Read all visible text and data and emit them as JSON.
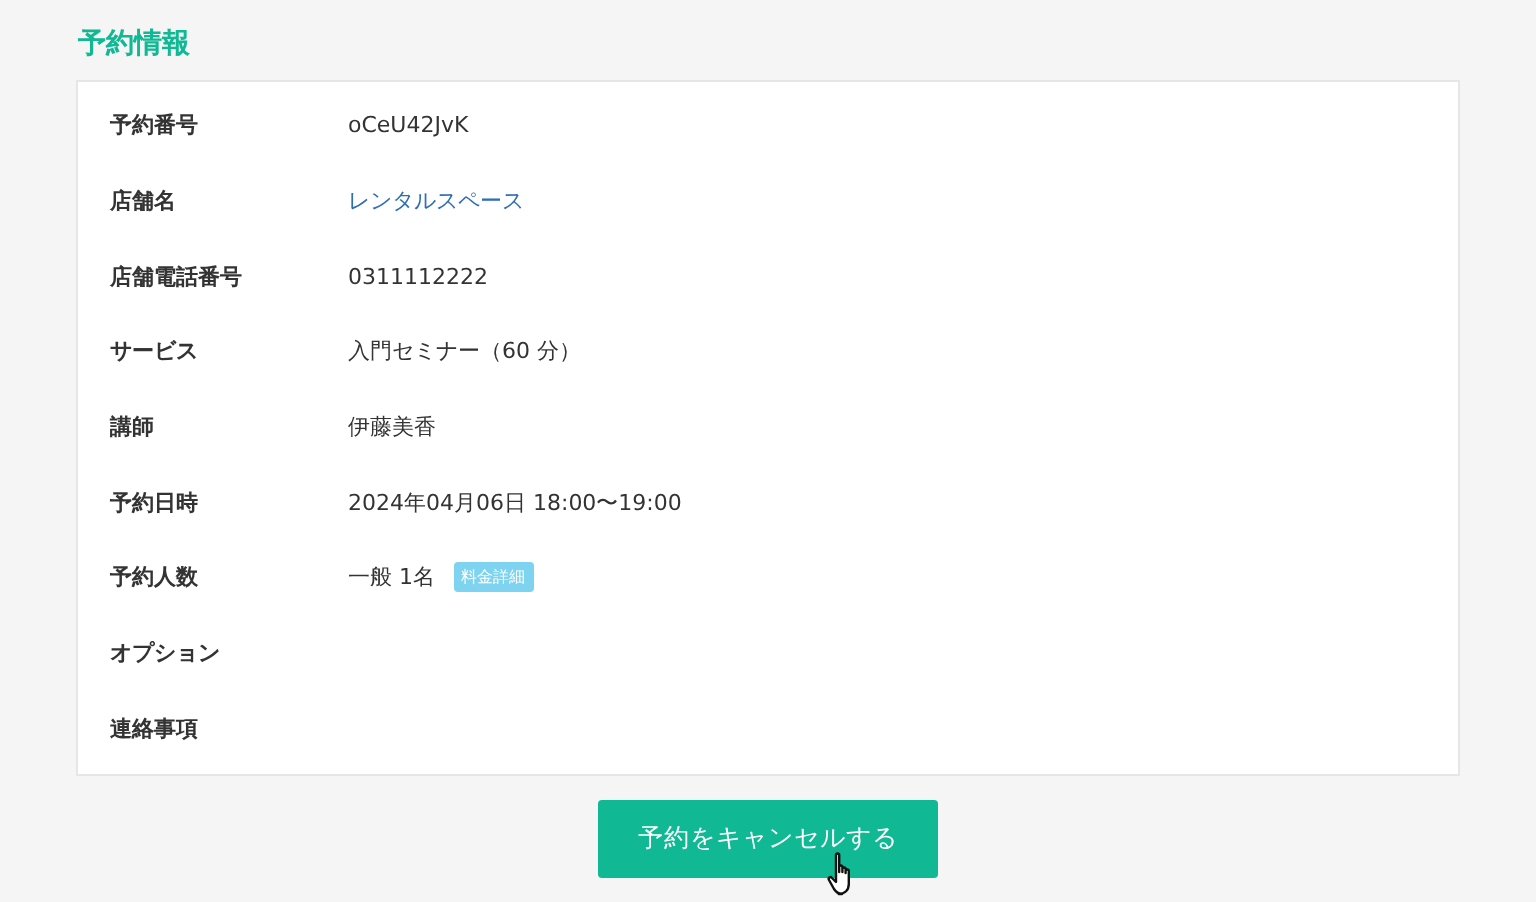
{
  "section_title": "予約情報",
  "rows": [
    {
      "kind": "text",
      "label": "予約番号",
      "value": "oCeU42JvK"
    },
    {
      "kind": "link",
      "label": "店舗名",
      "value": "レンタルスペース"
    },
    {
      "kind": "text",
      "label": "店舗電話番号",
      "value": "0311112222"
    },
    {
      "kind": "text",
      "label": "サービス",
      "value": "入門セミナー（60 分）"
    },
    {
      "kind": "text",
      "label": "講師",
      "value": "伊藤美香"
    },
    {
      "kind": "text",
      "label": "予約日時",
      "value": "2024年04月06日 18:00〜19:00"
    },
    {
      "kind": "badge",
      "label": "予約人数",
      "value": "一般 1名",
      "badge": "料金詳細"
    },
    {
      "kind": "empty",
      "label": "オプション"
    },
    {
      "kind": "empty",
      "label": "連絡事項"
    }
  ],
  "cancel_button": "予約をキャンセルする"
}
